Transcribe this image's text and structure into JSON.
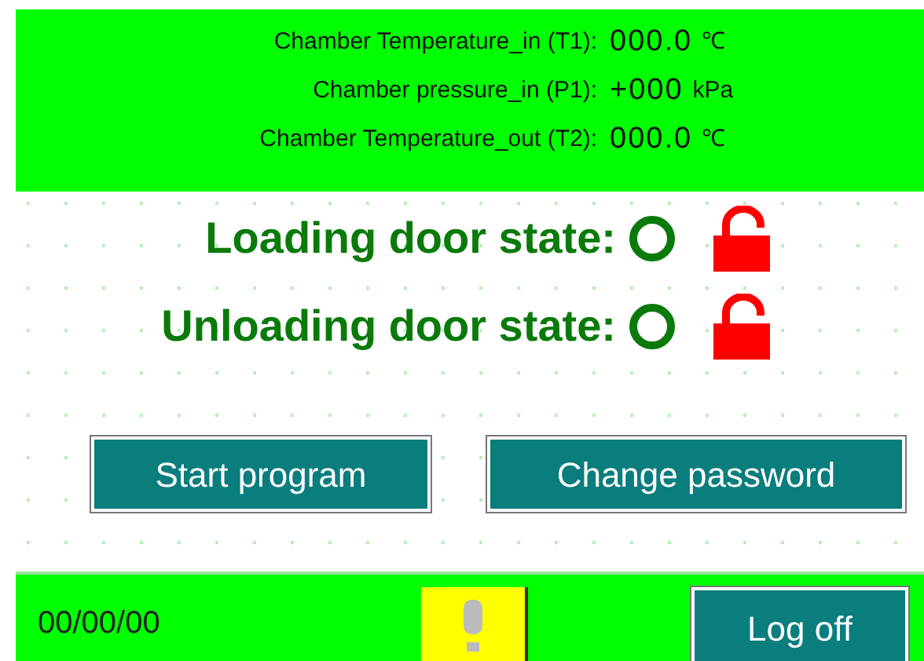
{
  "readings": [
    {
      "label": "Chamber Temperature_in (T1):",
      "value": "000.0",
      "unit": "℃"
    },
    {
      "label": "Chamber pressure_in (P1):",
      "value": "+000",
      "unit": "kPa"
    },
    {
      "label": "Chamber Temperature_out (T2):",
      "value": "000.0",
      "unit": "℃"
    }
  ],
  "doors": [
    {
      "label": "Loading door state:",
      "locked": false
    },
    {
      "label": "Unloading door state:",
      "locked": false
    }
  ],
  "buttons": [
    "Start program",
    "Change password"
  ],
  "status_bar": {
    "date": "00/00/00",
    "logoff": "Log off"
  }
}
